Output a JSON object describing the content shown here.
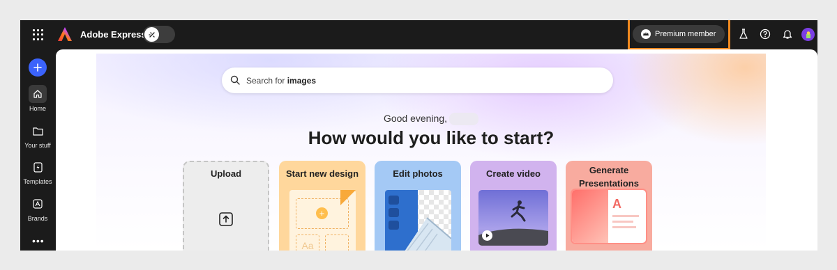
{
  "app": {
    "title": "Adobe Express"
  },
  "topbar": {
    "premium_label": "Premium member"
  },
  "sidebar": {
    "items": [
      {
        "label": "Home"
      },
      {
        "label": "Your stuff"
      },
      {
        "label": "Templates"
      },
      {
        "label": "Brands"
      }
    ]
  },
  "search": {
    "prefix": "Search for ",
    "keyword": "images"
  },
  "hero": {
    "greeting": "Good evening,",
    "headline": "How would you like to start?"
  },
  "cards": [
    {
      "title": "Upload"
    },
    {
      "title": "Start new design"
    },
    {
      "title": "Edit photos"
    },
    {
      "title": "Create video"
    },
    {
      "title": "Generate Presentations"
    }
  ],
  "colors": {
    "accent": "#3b63fb",
    "highlight": "#f0891f",
    "topbar_bg": "#1b1b1b"
  }
}
